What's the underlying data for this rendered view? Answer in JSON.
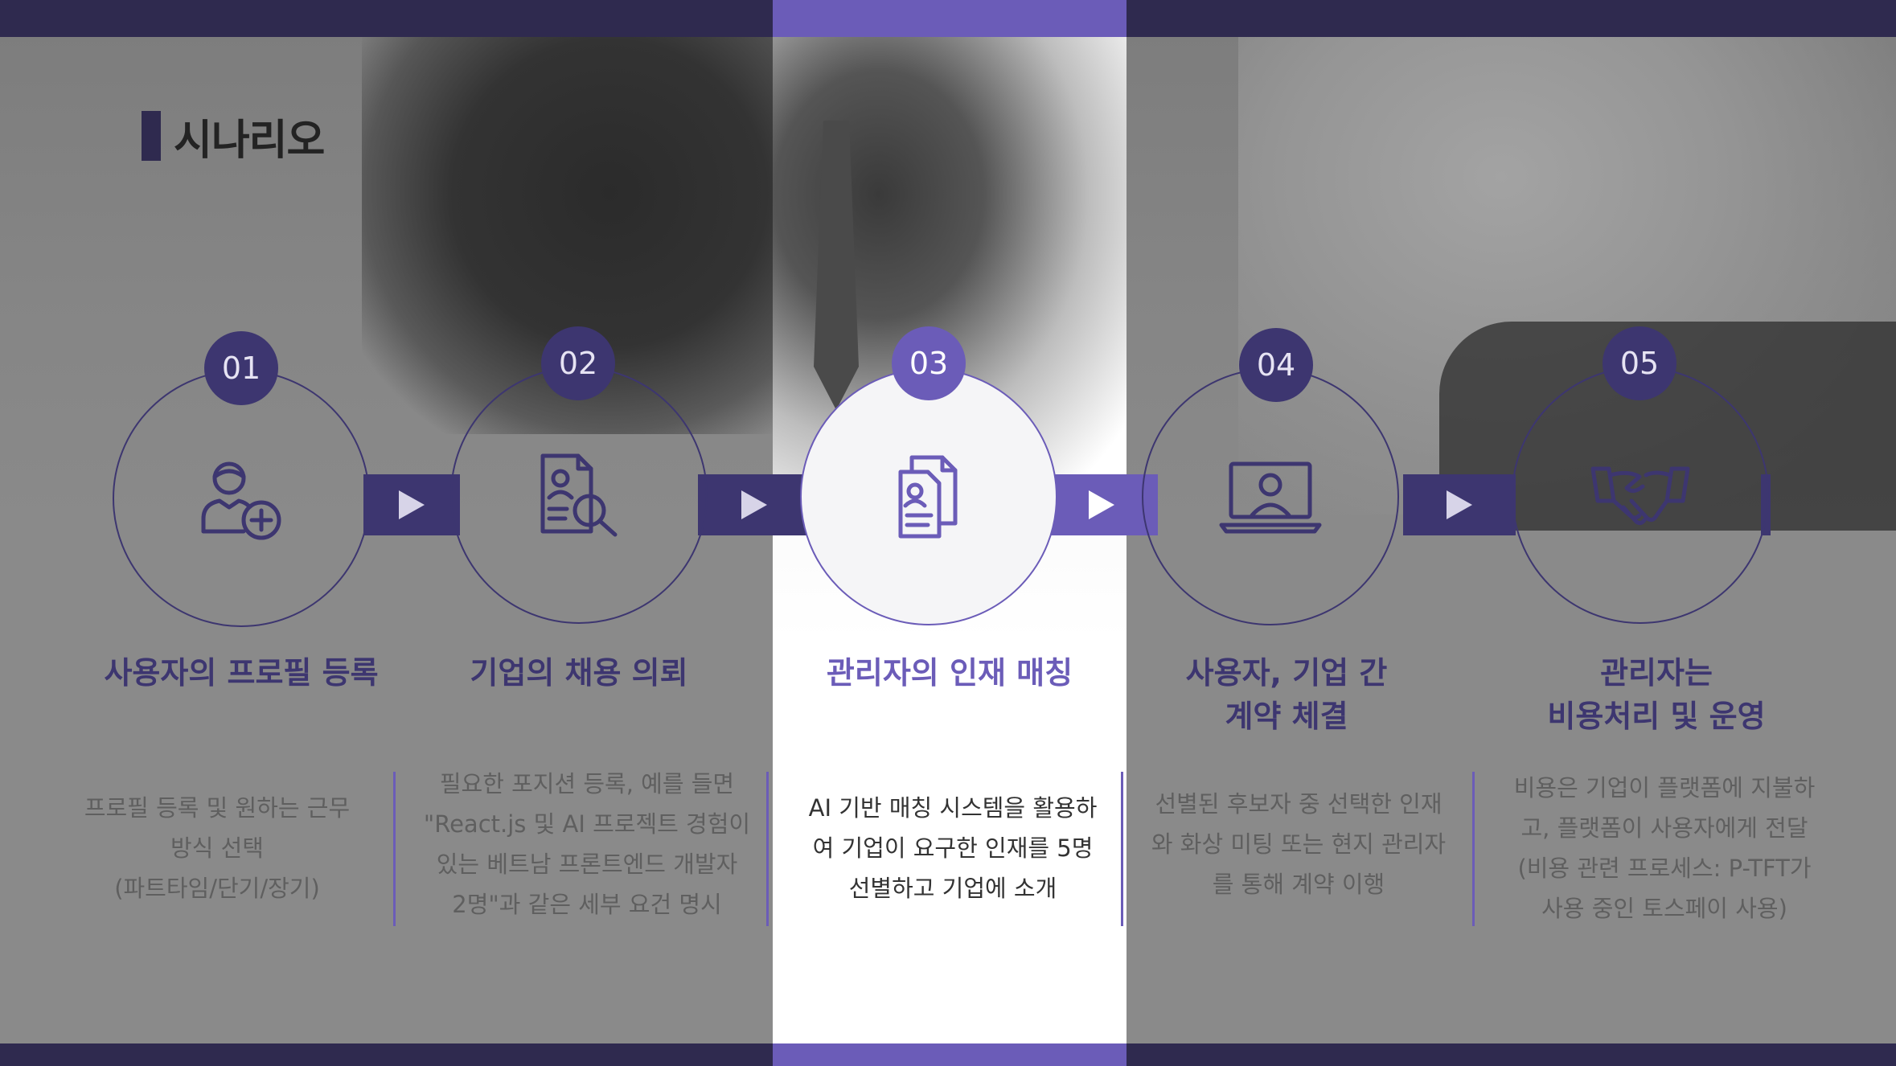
{
  "slide": {
    "title": "시나리오",
    "colors": {
      "dark": "#2f2a4f",
      "primary": "#3d3670",
      "accent": "#6b5cb8"
    },
    "steps": [
      {
        "number": "01",
        "icon": "user-add-icon",
        "title": "사용자의 프로필 등록",
        "desc": "프로필 등록 및 원하는 근무\n방식 선택\n(파트타임/단기/장기)"
      },
      {
        "number": "02",
        "icon": "document-search-icon",
        "title": "기업의 채용 의뢰",
        "desc": "필요한 포지션 등록, 예를 들면\n\"React.js 및 AI 프로젝트 경험이\n있는 베트남 프론트엔드 개발자\n2명\"과 같은 세부 요건 명시"
      },
      {
        "number": "03",
        "icon": "resume-documents-icon",
        "title": "관리자의 인재 매칭",
        "desc": "AI 기반 매칭 시스템을 활용하\n여 기업이 요구한 인재를 5명\n선별하고 기업에 소개"
      },
      {
        "number": "04",
        "icon": "video-meeting-laptop-icon",
        "title": "사용자, 기업 간\n계약 체결",
        "desc": "선별된 후보자 중 선택한 인재\n와 화상 미팅 또는 현지 관리자\n를 통해 계약 이행"
      },
      {
        "number": "05",
        "icon": "handshake-icon",
        "title": "관리자는\n비용처리 및 운영",
        "desc": "비용은 기업이 플랫폼에 지불하\n고, 플랫폼이 사용자에게 전달\n(비용 관련 프로세스: P-TFT가\n사용 중인 토스페이 사용)"
      }
    ]
  }
}
